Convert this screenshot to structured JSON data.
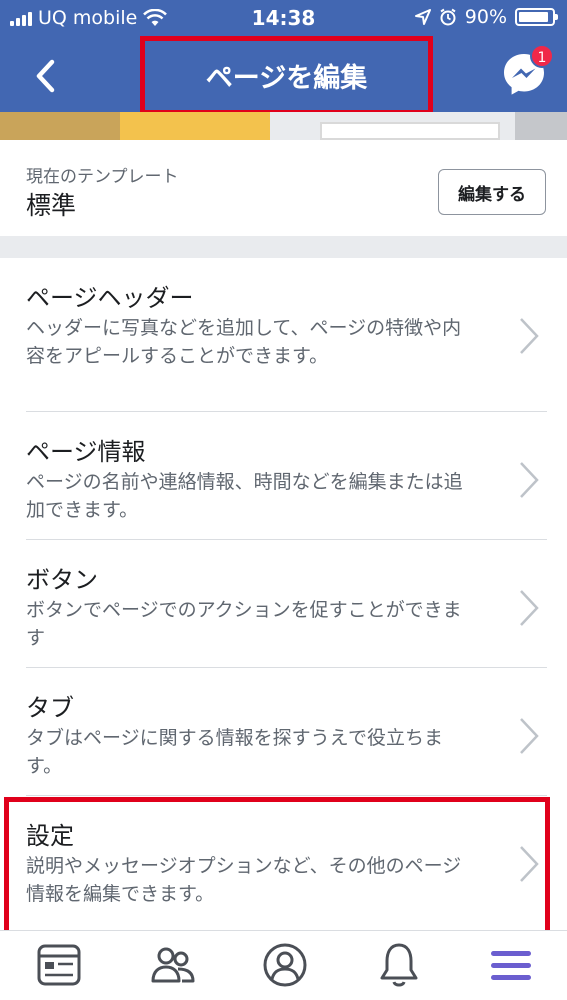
{
  "status": {
    "carrier": "UQ mobile",
    "time": "14:38",
    "battery": "90%",
    "battery_level": 0.9
  },
  "nav": {
    "title": "ページを編集",
    "messenger_badge": "1"
  },
  "template": {
    "label": "現在のテンプレート",
    "value": "標準",
    "edit_button": "編集する"
  },
  "sections": [
    {
      "title": "ページヘッダー",
      "desc": "ヘッダーに写真などを追加して、ページの特徴や内容をアピールすることができます。"
    },
    {
      "title": "ページ情報",
      "desc": "ページの名前や連絡情報、時間などを編集または追加できます。"
    },
    {
      "title": "ボタン",
      "desc": "ボタンでページでのアクションを促すことができます"
    },
    {
      "title": "タブ",
      "desc": "タブはページに関する情報を探すうえで役立ちます。"
    },
    {
      "title": "設定",
      "desc": "説明やメッセージオプションなど、その他のページ情報を編集できます。"
    }
  ],
  "tabbar": [
    "news-feed-icon",
    "groups-icon",
    "profile-icon",
    "notifications-icon",
    "menu-icon"
  ],
  "colors": {
    "brand": "#4267b2",
    "highlight": "#e0001b",
    "badge": "#f02849",
    "active_tab": "#6b5ecf"
  }
}
